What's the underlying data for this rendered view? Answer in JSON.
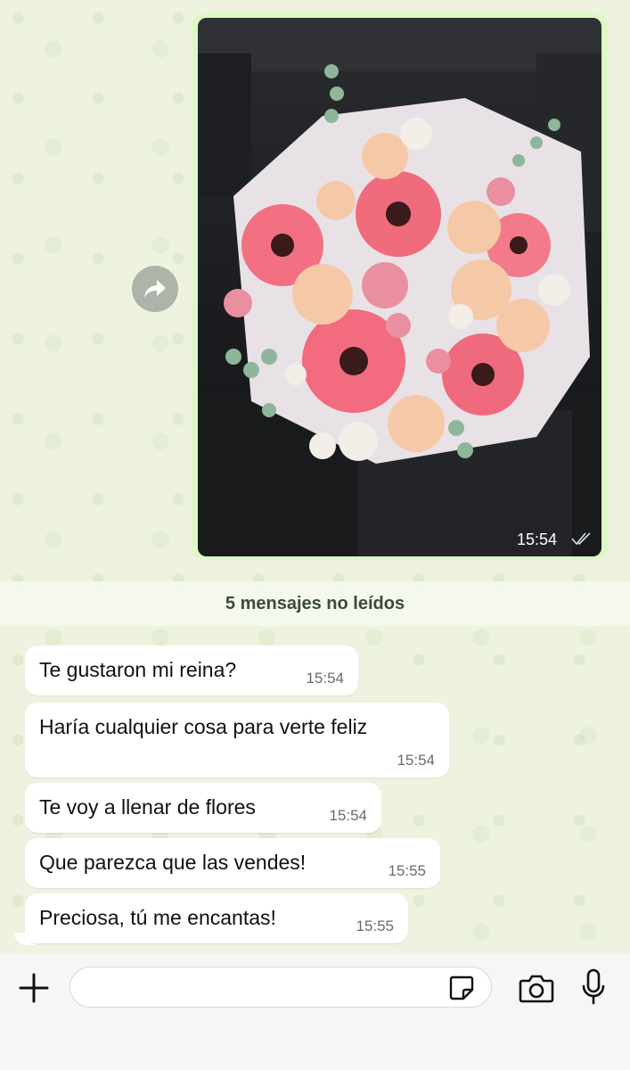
{
  "image_message": {
    "time": "15:54",
    "status_icon": "double-check-icon",
    "photo_subject": "bouquet of pink gerberas and peach roses in a car"
  },
  "forward_icon": "forward-arrow-icon",
  "unread_divider": "5 mensajes no leídos",
  "messages": [
    {
      "text": "Te gustaron mi reina?",
      "time": "15:54"
    },
    {
      "text": "Haría cualquier cosa para verte feliz",
      "time": "15:54"
    },
    {
      "text": "Te voy a llenar de flores",
      "time": "15:54"
    },
    {
      "text": "Que parezca que las vendes!",
      "time": "15:55"
    },
    {
      "text": "Preciosa, tú me encantas!",
      "time": "15:55"
    }
  ],
  "composer": {
    "placeholder": "",
    "icons": [
      "plus-icon",
      "sticker-icon",
      "camera-icon",
      "microphone-icon"
    ]
  },
  "colors": {
    "chat_background": "#edf3df",
    "outgoing_bubble": "#dcf8c6",
    "incoming_bubble": "#ffffff",
    "divider_text": "#3b4a3f"
  }
}
